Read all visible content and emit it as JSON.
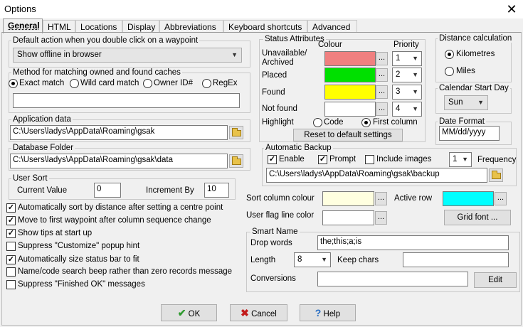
{
  "window": {
    "title": "Options",
    "close_glyph": "✕"
  },
  "tabs": [
    {
      "label": "General"
    },
    {
      "label": "HTML"
    },
    {
      "label": "Locations"
    },
    {
      "label": "Display"
    },
    {
      "label": "Abbreviations"
    },
    {
      "label": "Keyboard shortcuts"
    },
    {
      "label": "Advanced"
    }
  ],
  "default_action": {
    "label": "Default action when you double click on a waypoint",
    "value": "Show offline in browser"
  },
  "matching": {
    "label": "Method for matching owned and found caches",
    "options": [
      "Exact match",
      "Wild card match",
      "Owner ID#",
      "RegEx"
    ],
    "selected": "Exact match",
    "value": ""
  },
  "application_data": {
    "label": "Application data",
    "path": "C:\\Users\\ladys\\AppData\\Roaming\\gsak"
  },
  "database_folder": {
    "label": "Database Folder",
    "path": "C:\\Users\\ladys\\AppData\\Roaming\\gsak\\data"
  },
  "user_sort": {
    "label": "User Sort",
    "current_label": "Current Value",
    "current_value": "0",
    "increment_label": "Increment By",
    "increment_value": "10"
  },
  "checkboxes": [
    {
      "label": "Automatically sort by distance after setting a centre point",
      "checked": true
    },
    {
      "label": "Move to first waypoint after column sequence change",
      "checked": true
    },
    {
      "label": "Show tips at start up",
      "checked": true
    },
    {
      "label": "Suppress \"Customize\" popup hint",
      "checked": false
    },
    {
      "label": "Automatically size status bar to fit",
      "checked": true
    },
    {
      "label": "Name/code search beep rather than zero records message",
      "checked": false
    },
    {
      "label": "Suppress \"Finished OK\" messages",
      "checked": false
    }
  ],
  "status_attributes": {
    "label": "Status Attributes",
    "colour_header": "Colour",
    "priority_header": "Priority",
    "rows": [
      {
        "label": "Unavailable/\nArchived",
        "color": "#f08080",
        "priority": "1"
      },
      {
        "label": "Placed",
        "color": "#00e000",
        "priority": "2"
      },
      {
        "label": "Found",
        "color": "#ffff00",
        "priority": "3"
      },
      {
        "label": "Not found",
        "color": "#ffffff",
        "priority": "4"
      }
    ],
    "highlight_label": "Highlight",
    "highlight_options": [
      "Code",
      "First column"
    ],
    "highlight_selected": "First column",
    "reset_label": "Reset to default settings",
    "dots": "..."
  },
  "distance_calculation": {
    "label": "Distance calculation",
    "options": [
      "Kilometres",
      "Miles"
    ],
    "selected": "Kilometres"
  },
  "calendar_start_day": {
    "label": "Calendar Start Day",
    "value": "Sun"
  },
  "date_format": {
    "label": "Date Format",
    "value": "MM/dd/yyyy"
  },
  "automatic_backup": {
    "label": "Automatic Backup",
    "enable_label": "Enable",
    "enable": true,
    "prompt_label": "Prompt",
    "prompt": true,
    "include_images_label": "Include images",
    "include_images": false,
    "frequency_value": "1",
    "frequency_label": "Frequency",
    "path": "C:\\Users\\ladys\\AppData\\Roaming\\gsak\\backup"
  },
  "sort_column_colour": {
    "label": "Sort column colour",
    "color": "#ffffe0"
  },
  "active_row": {
    "label": "Active row",
    "color": "#00ffff"
  },
  "user_flag_line_color": {
    "label": "User flag line color",
    "color": "#ffffff"
  },
  "grid_font_label": "Grid font ...",
  "smart_name": {
    "label": "Smart Name",
    "drop_words_label": "Drop words",
    "drop_words": "the;this;a;is",
    "length_label": "Length",
    "length_value": "8",
    "keep_chars_label": "Keep chars",
    "keep_chars": "",
    "conversions_label": "Conversions",
    "conversions": "",
    "edit_label": "Edit"
  },
  "buttons": {
    "ok": "OK",
    "cancel": "Cancel",
    "help": "Help"
  },
  "icons": {
    "ok": "check-icon",
    "cancel": "x-icon",
    "help": "help-icon",
    "folder": "folder-icon"
  }
}
